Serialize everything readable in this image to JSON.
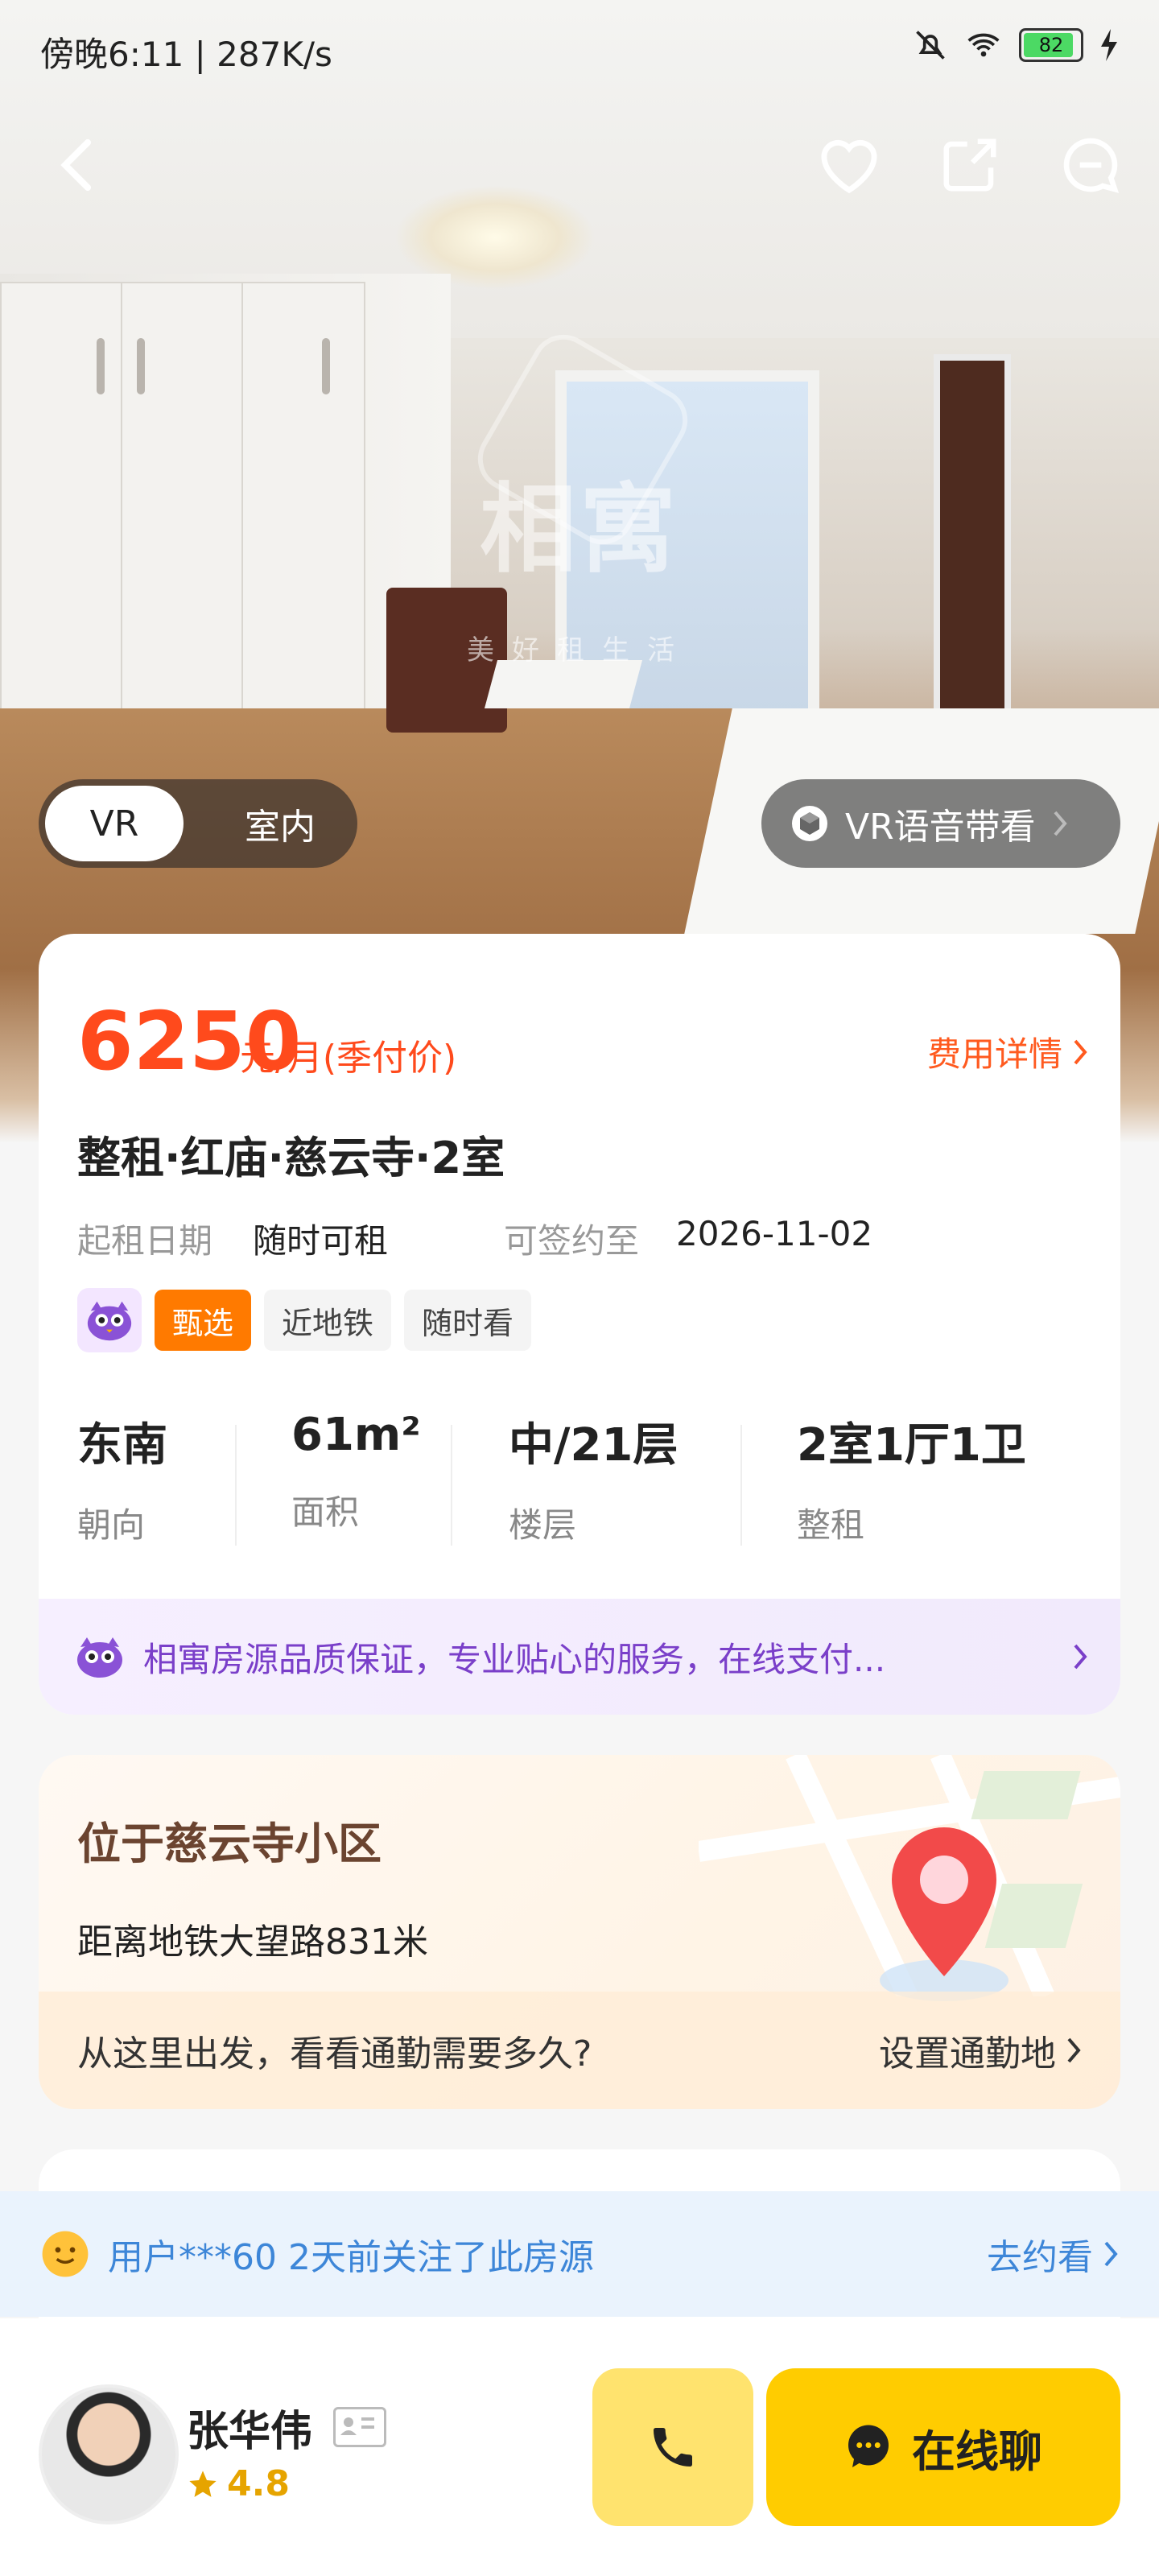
{
  "status_bar": {
    "time": "傍晚6:11 | 287K/s",
    "battery": "82"
  },
  "hero": {
    "watermark": "相寓",
    "watermark_sub": "美好租生活",
    "vr_tabs": [
      {
        "label": "VR",
        "active": true
      },
      {
        "label": "室内",
        "active": false
      }
    ],
    "vr_voice_label": "VR语音带看"
  },
  "listing": {
    "price": "6250",
    "price_unit": "元/月(季付价)",
    "fee_link": "费用详情",
    "title": "整租·红庙·慈云寺·2室",
    "start_date_label": "起租日期",
    "start_date_value": "随时可租",
    "sign_until_label": "可签约至",
    "sign_until_value": "2026-11-02",
    "tags": [
      "甄选",
      "近地铁",
      "随时看"
    ],
    "stats": [
      {
        "value": "东南",
        "label": "朝向"
      },
      {
        "value": "61m²",
        "label": "面积"
      },
      {
        "value": "中/21层",
        "label": "楼层"
      },
      {
        "value": "2室1厅1卫",
        "label": "整租"
      }
    ],
    "promise": "相寓房源品质保证，专业贴心的服务，在线支付..."
  },
  "location": {
    "title": "位于慈云寺小区",
    "subway": "距离地铁大望路831米",
    "commute_text": "从这里出发，看看通勤需要多久?",
    "commute_link": "设置通勤地"
  },
  "notify": {
    "text": "用户***60 2天前关注了此房源",
    "action": "去约看"
  },
  "agent": {
    "name": "张华伟",
    "rating": "4.8",
    "chat_label": "在线聊"
  },
  "colors": {
    "accent": "#ff4a1c",
    "purple": "#7a3fc9",
    "yellow": "#ffcc00",
    "blue": "#3d86d8"
  }
}
